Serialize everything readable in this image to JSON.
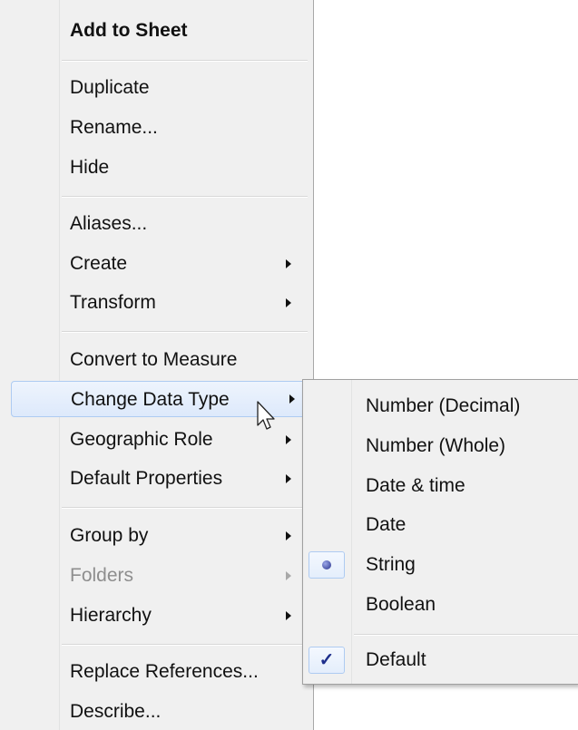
{
  "main_menu": {
    "add_to_sheet": "Add to Sheet",
    "duplicate": "Duplicate",
    "rename": "Rename...",
    "hide": "Hide",
    "aliases": "Aliases...",
    "create": "Create",
    "transform": "Transform",
    "convert_to_measure": "Convert to Measure",
    "change_data_type": "Change Data Type",
    "geographic_role": "Geographic Role",
    "default_properties": "Default Properties",
    "group_by": "Group by",
    "folders": "Folders",
    "hierarchy": "Hierarchy",
    "replace_references": "Replace References...",
    "describe": "Describe..."
  },
  "data_type_submenu": {
    "number_decimal": "Number (Decimal)",
    "number_whole": "Number (Whole)",
    "date_time": "Date & time",
    "date": "Date",
    "string": "String",
    "boolean": "Boolean",
    "default": "Default",
    "selected_type": "String",
    "default_checked": true
  },
  "icons": {
    "submenu_arrow": "triangle-right",
    "radio_selected": "dot",
    "checkmark": "✓"
  },
  "colors": {
    "menu_bg": "#f0f0f0",
    "highlight_border": "#aecbf2",
    "highlight_bg": "#e6effc"
  }
}
